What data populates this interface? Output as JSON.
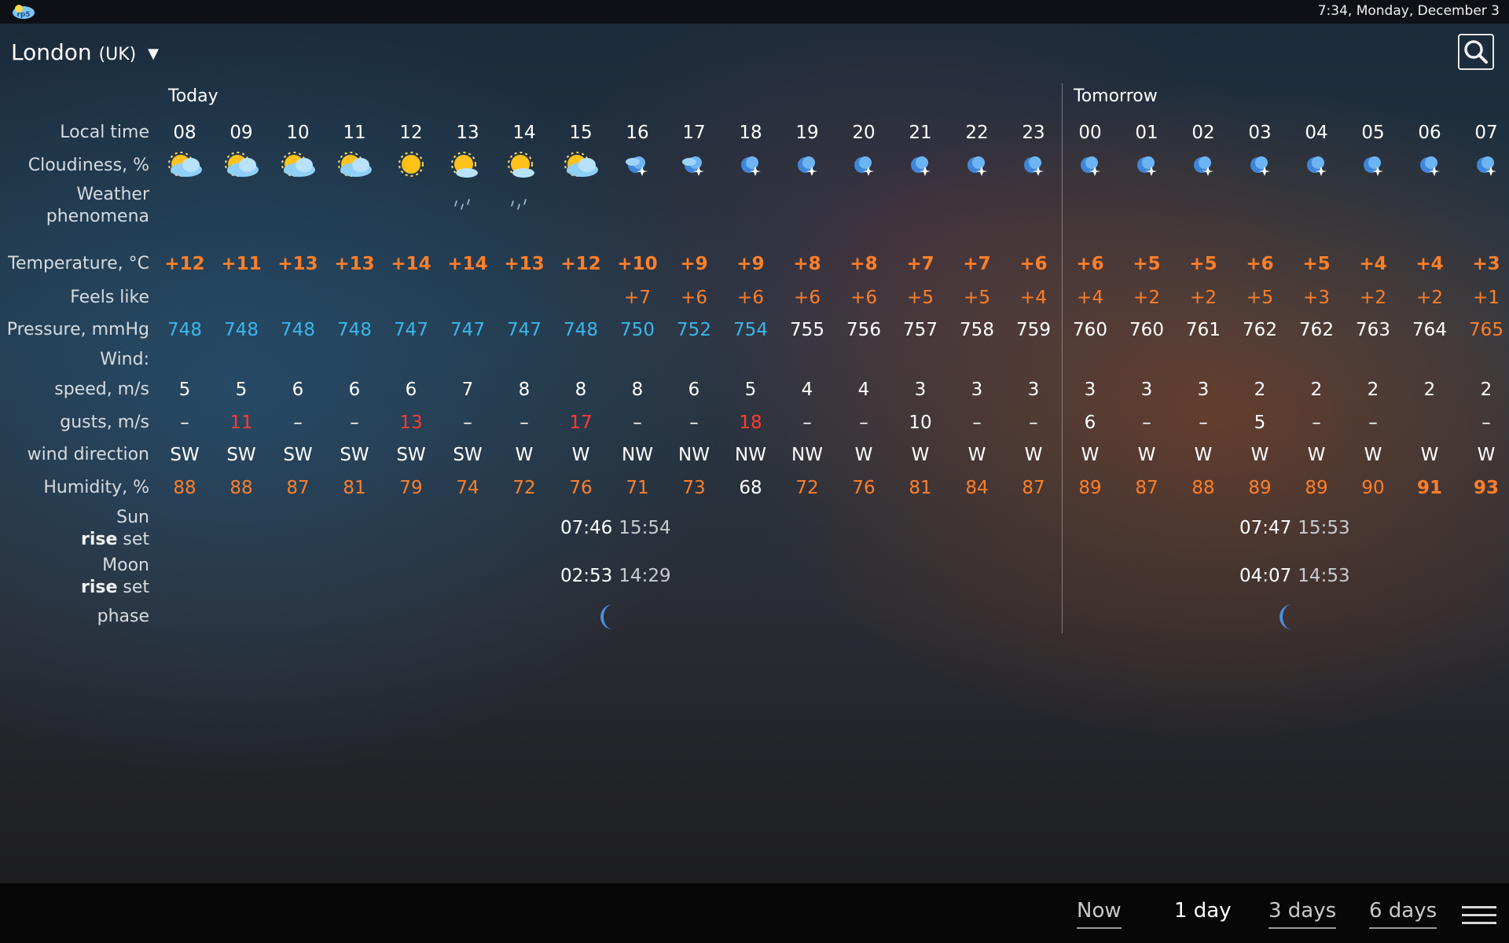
{
  "status_bar": {
    "app_icon_label": "rp5",
    "clock": "7:34, Monday, December 3"
  },
  "location": {
    "city": "London",
    "country": "(UK)"
  },
  "day_labels": {
    "today": "Today",
    "tomorrow": "Tomorrow"
  },
  "row_labels": {
    "local_time": "Local time",
    "cloudiness": "Cloudiness, %",
    "weather_line1": "Weather",
    "weather_line2": "phenomena",
    "temperature": "Temperature, °C",
    "feels_like": "Feels like",
    "pressure": "Pressure, mmHg",
    "wind": "Wind:",
    "speed": "speed, m/s",
    "gusts": "gusts, m/s",
    "wind_direction": "wind direction",
    "humidity": "Humidity, %",
    "sun": "Sun",
    "moon": "Moon",
    "rise": "rise",
    "set": "set",
    "phase": "phase"
  },
  "hours": [
    "08",
    "09",
    "10",
    "11",
    "12",
    "13",
    "14",
    "15",
    "16",
    "17",
    "18",
    "19",
    "20",
    "21",
    "22",
    "23",
    "00",
    "01",
    "02",
    "03",
    "04",
    "05",
    "06",
    "07"
  ],
  "cloud_icons": [
    "sun-cloud",
    "sun-cloud",
    "sun-cloud",
    "sun-cloud",
    "sun",
    "sun-cloud-small",
    "sun-cloud-small",
    "sun-cloud",
    "moon-star",
    "moon-star",
    "moon",
    "moon",
    "moon",
    "moon",
    "moon",
    "moon",
    "moon",
    "moon",
    "moon",
    "moon",
    "moon",
    "moon",
    "moon",
    "moon"
  ],
  "rain_columns": [
    5,
    6
  ],
  "temperature": [
    "+12",
    "+11",
    "+13",
    "+13",
    "+14",
    "+14",
    "+13",
    "+12",
    "+10",
    "+9",
    "+9",
    "+8",
    "+8",
    "+7",
    "+7",
    "+6",
    "+6",
    "+5",
    "+5",
    "+6",
    "+5",
    "+4",
    "+4",
    "+3"
  ],
  "feels_like": [
    "",
    "",
    "",
    "",
    "",
    "",
    "",
    "",
    "+7",
    "+6",
    "+6",
    "+6",
    "+6",
    "+5",
    "+5",
    "+4",
    "+4",
    "+2",
    "+2",
    "+5",
    "+3",
    "+2",
    "+2",
    "+1"
  ],
  "pressure": [
    "748",
    "748",
    "748",
    "748",
    "747",
    "747",
    "747",
    "748",
    "750",
    "752",
    "754",
    "755",
    "756",
    "757",
    "758",
    "759",
    "760",
    "760",
    "761",
    "762",
    "762",
    "763",
    "764",
    "765"
  ],
  "pressure_styles": [
    "blue",
    "blue",
    "blue",
    "blue",
    "blue",
    "blue",
    "blue",
    "blue",
    "blue",
    "blue",
    "blue",
    "white",
    "white",
    "white",
    "white",
    "white",
    "white",
    "white",
    "white",
    "white",
    "white",
    "white",
    "white",
    "orange"
  ],
  "wind_speed": [
    "5",
    "5",
    "6",
    "6",
    "6",
    "7",
    "8",
    "8",
    "8",
    "6",
    "5",
    "4",
    "4",
    "3",
    "3",
    "3",
    "3",
    "3",
    "3",
    "2",
    "2",
    "2",
    "2",
    "2"
  ],
  "gusts": [
    "–",
    "11",
    "–",
    "–",
    "13",
    "–",
    "–",
    "17",
    "–",
    "–",
    "18",
    "–",
    "–",
    "10",
    "–",
    "–",
    "6",
    "–",
    "–",
    "5",
    "–",
    "–",
    "",
    "–"
  ],
  "gust_styles": [
    "white",
    "red",
    "white",
    "white",
    "red",
    "white",
    "white",
    "red",
    "white",
    "white",
    "red",
    "white",
    "white",
    "white",
    "white",
    "white",
    "white",
    "white",
    "white",
    "white",
    "white",
    "white",
    "white",
    "white"
  ],
  "wind_direction": [
    "SW",
    "SW",
    "SW",
    "SW",
    "SW",
    "SW",
    "W",
    "W",
    "NW",
    "NW",
    "NW",
    "NW",
    "W",
    "W",
    "W",
    "W",
    "W",
    "W",
    "W",
    "W",
    "W",
    "W",
    "W",
    "W"
  ],
  "humidity": [
    "88",
    "88",
    "87",
    "81",
    "79",
    "74",
    "72",
    "76",
    "71",
    "73",
    "68",
    "72",
    "76",
    "81",
    "84",
    "87",
    "89",
    "87",
    "88",
    "89",
    "89",
    "90",
    "91",
    "93"
  ],
  "humidity_styles": [
    "orange",
    "orange",
    "orange",
    "orange",
    "orange",
    "orange",
    "orange",
    "orange",
    "orange",
    "orange",
    "white",
    "orange",
    "orange",
    "orange",
    "orange",
    "orange",
    "orange",
    "orange",
    "orange",
    "orange",
    "orange",
    "orange",
    "orange-b",
    "orange-b"
  ],
  "sun_today": {
    "rise": "07:46",
    "set": "15:54"
  },
  "sun_tomorrow": {
    "rise": "07:47",
    "set": "15:53"
  },
  "moon_today": {
    "rise": "02:53",
    "set": "14:29"
  },
  "moon_tomorrow": {
    "rise": "04:07",
    "set": "14:53"
  },
  "moon_phase_icon": "waning-crescent-moon",
  "nav": {
    "now": "Now",
    "one_day": "1 day",
    "three_days": "3 days",
    "six_days": "6 days",
    "active": "1 day"
  }
}
